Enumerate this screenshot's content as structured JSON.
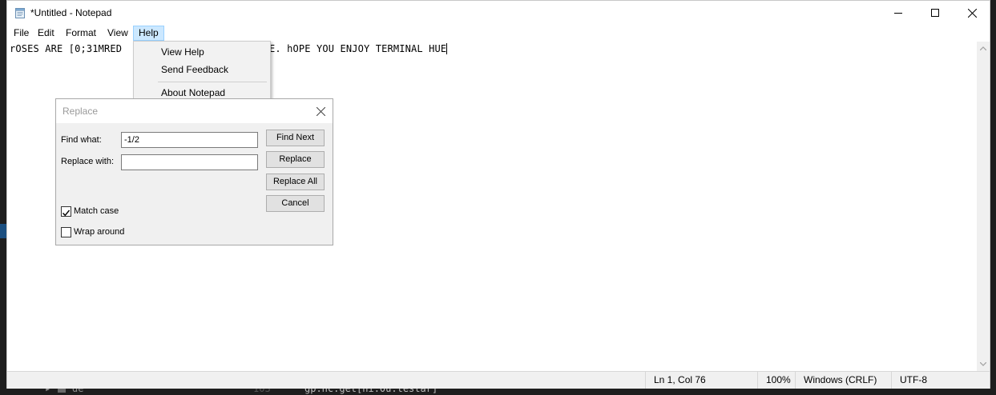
{
  "window": {
    "title": "*Untitled - Notepad",
    "controls": {
      "minimize": "minimize",
      "maximize": "maximize",
      "close": "close"
    }
  },
  "menu": [
    "File",
    "Edit",
    "Format",
    "View",
    "Help"
  ],
  "help_menu": {
    "items": [
      "View Help",
      "Send Feedback",
      "About Notepad"
    ]
  },
  "editor": {
    "before_menu": "rOSES ARE [0;31MRED",
    "after_menu": "4MBLUE. hOPE YOU ENJOY TERMINAL HUE"
  },
  "replace_dialog": {
    "title": "Replace",
    "find_label": "Find what:",
    "find_value": "-1/2",
    "replace_label": "Replace with:",
    "replace_value": "",
    "buttons": {
      "find_next": "Find Next",
      "replace": "Replace",
      "replace_all": "Replace All",
      "cancel": "Cancel"
    },
    "match_case": {
      "label": "Match case",
      "checked": true
    },
    "wrap_around": {
      "label": "Wrap around",
      "checked": false
    }
  },
  "statusbar": {
    "position": "Ln 1, Col 76",
    "zoom": "100%",
    "line_ending": "Windows (CRLF)",
    "encoding": "UTF-8"
  },
  "background": {
    "line_number": "103",
    "tree_item": "de",
    "code_fragment": "gp.hc.get[hi.0u.testar]"
  }
}
